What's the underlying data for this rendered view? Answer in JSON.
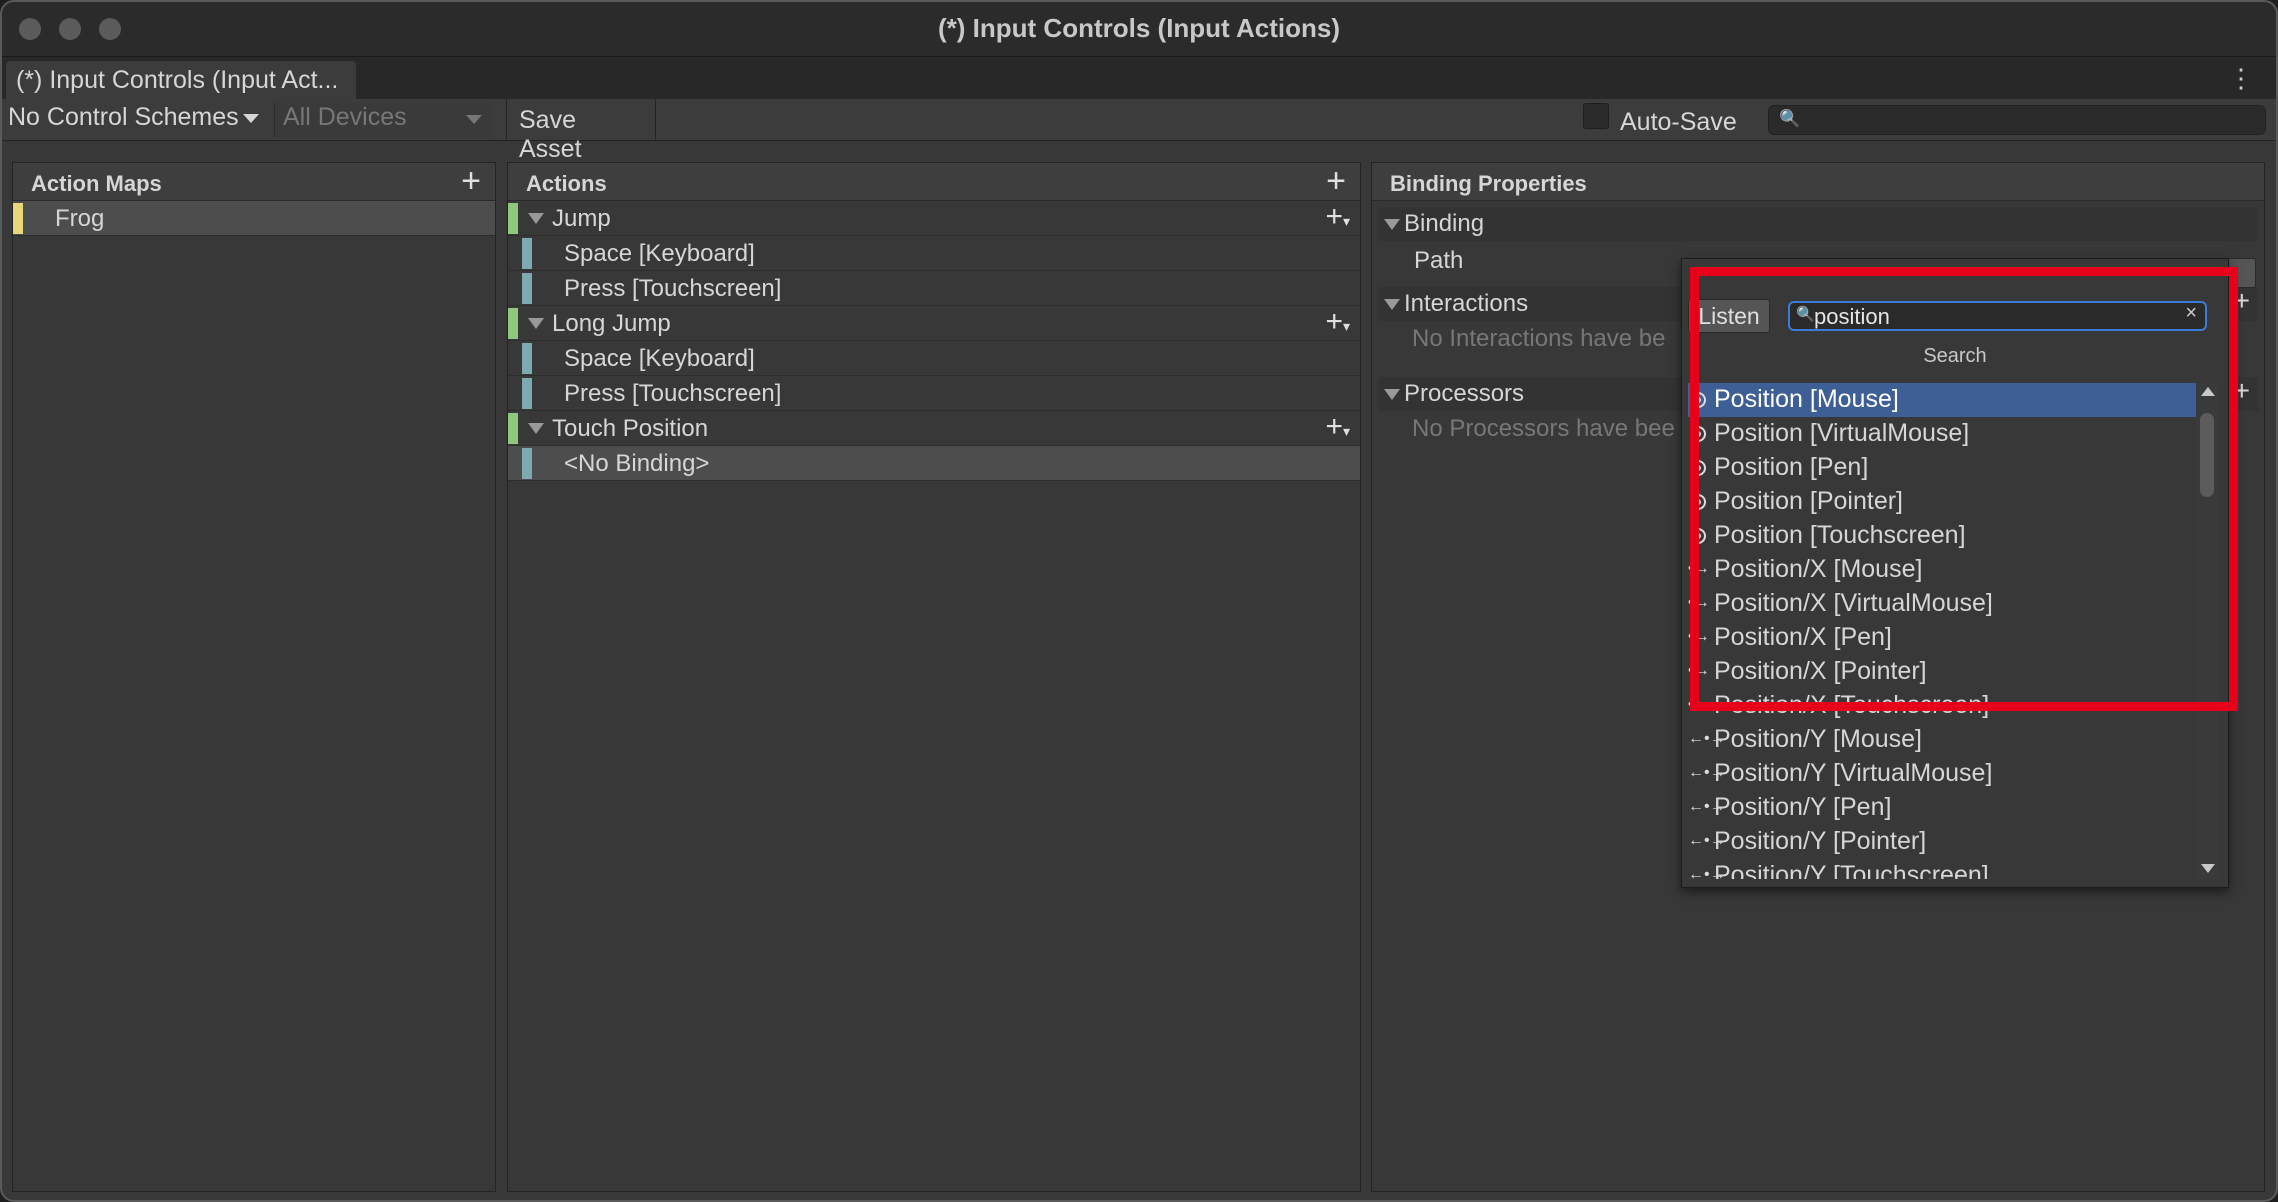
{
  "window": {
    "title": "(*) Input Controls (Input Actions)",
    "tab_label": "(*) Input Controls (Input Act..."
  },
  "toolbar": {
    "control_schemes": "No Control Schemes",
    "devices": "All Devices",
    "save_asset": "Save Asset",
    "auto_save": "Auto-Save",
    "auto_save_checked": false
  },
  "action_maps": {
    "title": "Action Maps",
    "items": [
      {
        "label": "Frog",
        "color": "#e8d77a"
      }
    ]
  },
  "actions": {
    "title": "Actions",
    "groups": [
      {
        "label": "Jump",
        "bindings": [
          "Space [Keyboard]",
          "Press [Touchscreen]"
        ]
      },
      {
        "label": "Long Jump",
        "bindings": [
          "Space [Keyboard]",
          "Press [Touchscreen]"
        ]
      },
      {
        "label": "Touch Position",
        "bindings": [
          "<No Binding>"
        ]
      }
    ],
    "action_color": "#8fc77d",
    "binding_color": "#7fa9b0"
  },
  "binding_properties": {
    "title": "Binding Properties",
    "binding_section": "Binding",
    "path_label": "Path",
    "interactions_section": "Interactions",
    "interactions_empty": "No Interactions have be",
    "processors_section": "Processors",
    "processors_empty": "No Processors have bee"
  },
  "control_picker": {
    "listen_label": "Listen",
    "search_value": "position",
    "header": "Search",
    "items": [
      {
        "label": "Position [Mouse]",
        "icon": "vector-icon",
        "selected": true
      },
      {
        "label": "Position [VirtualMouse]",
        "icon": "vector-icon"
      },
      {
        "label": "Position [Pen]",
        "icon": "vector-icon"
      },
      {
        "label": "Position [Pointer]",
        "icon": "vector-icon"
      },
      {
        "label": "Position [Touchscreen]",
        "icon": "vector-icon"
      },
      {
        "label": "Position/X [Mouse]",
        "icon": "axis-icon"
      },
      {
        "label": "Position/X [VirtualMouse]",
        "icon": "axis-icon"
      },
      {
        "label": "Position/X [Pen]",
        "icon": "axis-icon"
      },
      {
        "label": "Position/X [Pointer]",
        "icon": "axis-icon"
      },
      {
        "label": "Position/X [Touchscreen]",
        "icon": "axis-icon"
      },
      {
        "label": "Position/Y [Mouse]",
        "icon": "axis-icon"
      },
      {
        "label": "Position/Y [VirtualMouse]",
        "icon": "axis-icon"
      },
      {
        "label": "Position/Y [Pen]",
        "icon": "axis-icon"
      },
      {
        "label": "Position/Y [Pointer]",
        "icon": "axis-icon"
      },
      {
        "label": "Position/Y [Touchscreen]",
        "icon": "axis-icon"
      }
    ],
    "highlight_color": "#e8001a"
  }
}
